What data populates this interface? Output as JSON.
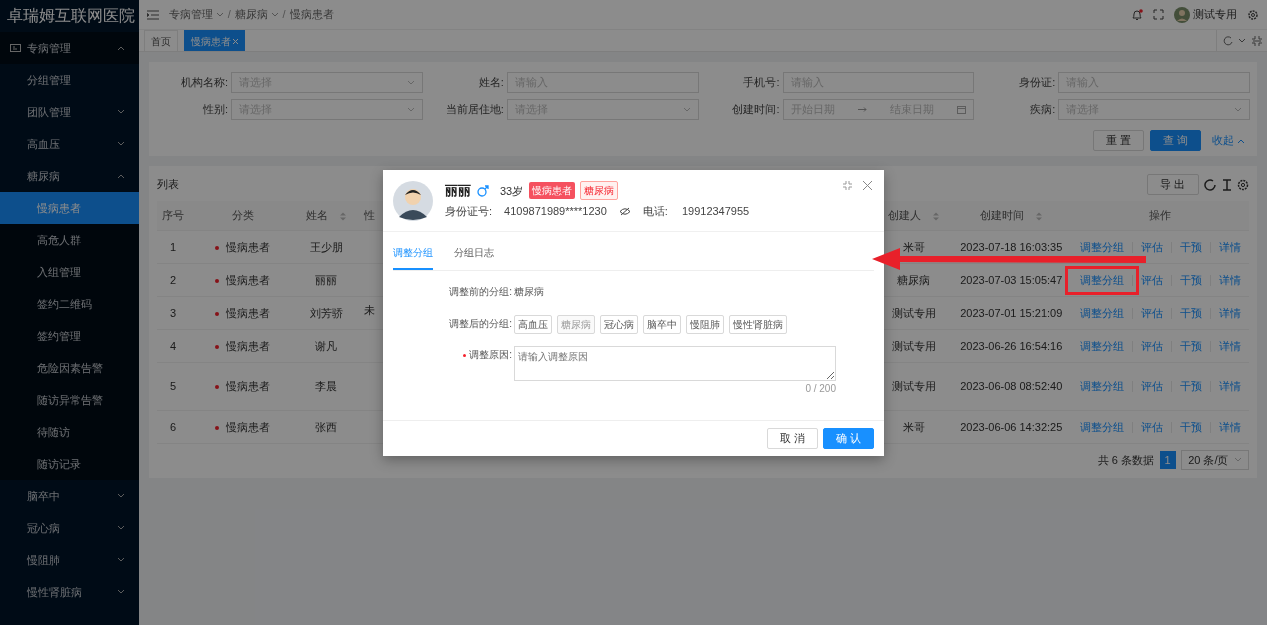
{
  "app_title": "卓瑞姆互联网医院",
  "sidebar": {
    "items": [
      {
        "label": "专病管理",
        "expanded": true,
        "children": [
          {
            "label": "分组管理"
          },
          {
            "label": "团队管理",
            "expanded": false
          },
          {
            "label": "高血压",
            "expanded": false
          },
          {
            "label": "糖尿病",
            "expanded": true,
            "children": [
              {
                "label": "慢病患者",
                "selected": true
              },
              {
                "label": "高危人群",
                "selected": false
              },
              {
                "label": "入组管理",
                "selected": false
              },
              {
                "label": "签约二维码",
                "selected": false
              },
              {
                "label": "签约管理",
                "selected": false
              },
              {
                "label": "危险因素告警",
                "selected": false
              },
              {
                "label": "随访异常告警",
                "selected": false
              },
              {
                "label": "待随访",
                "selected": false
              },
              {
                "label": "随访记录",
                "selected": false
              }
            ]
          },
          {
            "label": "脑卒中",
            "expanded": false
          },
          {
            "label": "冠心病",
            "expanded": false
          },
          {
            "label": "慢阻肺",
            "expanded": false
          },
          {
            "label": "慢性肾脏病",
            "expanded": false
          }
        ]
      }
    ]
  },
  "breadcrumb": {
    "separator": "/",
    "items": [
      {
        "label": "专病管理",
        "dropdown": true
      },
      {
        "label": "糖尿病",
        "dropdown": true
      },
      {
        "label": "慢病患者",
        "dropdown": false
      }
    ]
  },
  "user": {
    "name": "测试专用",
    "notification": true
  },
  "page_tabs": [
    {
      "label": "首页",
      "selected": false,
      "closable": false
    },
    {
      "label": "慢病患者",
      "selected": true,
      "closable": true
    }
  ],
  "filters": [
    {
      "label": "机构名称:",
      "placeholder": "请选择",
      "kind": "select"
    },
    {
      "label": "姓名:",
      "placeholder": "请输入",
      "kind": "input"
    },
    {
      "label": "手机号:",
      "placeholder": "请输入",
      "kind": "input"
    },
    {
      "label": "身份证:",
      "placeholder": "请输入",
      "kind": "input"
    },
    {
      "label": "性别:",
      "placeholder": "请选择",
      "kind": "select"
    },
    {
      "label": "当前居住地:",
      "placeholder": "请选择",
      "kind": "select"
    },
    {
      "label": "创建时间:",
      "placeholder": "开始日期",
      "placeholder_end": "结束日期",
      "kind": "daterange"
    },
    {
      "label": "疾病:",
      "placeholder": "请选择",
      "kind": "select"
    }
  ],
  "filter_buttons": {
    "reset": "重 置",
    "search": "查 询",
    "collapse": "收起"
  },
  "table": {
    "title": "列表",
    "export": "导 出",
    "columns": [
      {
        "label": "序号",
        "sortable": false
      },
      {
        "label": "分类",
        "sortable": false
      },
      {
        "label": "姓名",
        "sortable": true
      },
      {
        "label": "性",
        "sortable": false
      },
      {
        "label": "创建人",
        "sortable": true
      },
      {
        "label": "创建时间",
        "sortable": true
      },
      {
        "label": "操作",
        "sortable": false
      }
    ],
    "rows": [
      {
        "index": "1",
        "category": "慢病患者",
        "name": "王少朋",
        "column_4": "",
        "creator": "米哥",
        "created": "2023-07-18 16:03:35",
        "actions": [
          "调整分组",
          "评估",
          "干预",
          "详情"
        ],
        "highlighted": false
      },
      {
        "index": "2",
        "category": "慢病患者",
        "name": "丽丽",
        "column_4": "",
        "creator": "糖尿病",
        "created": "2023-07-03 15:05:47",
        "actions": [
          "调整分组",
          "评估",
          "干预",
          "详情"
        ],
        "highlighted": true
      },
      {
        "index": "3",
        "category": "慢病患者",
        "name": "刘芳骄",
        "column_4": "未",
        "creator": "测试专用",
        "created": "2023-07-01 15:21:09",
        "actions": [
          "调整分组",
          "评估",
          "干预",
          "详情"
        ],
        "highlighted": false
      },
      {
        "index": "4",
        "category": "慢病患者",
        "name": "谢凡",
        "column_4": "",
        "creator": "测试专用",
        "created": "2023-06-26 16:54:16",
        "actions": [
          "调整分组",
          "评估",
          "干预",
          "详情"
        ],
        "highlighted": false
      },
      {
        "index": "5",
        "category": "慢病患者",
        "name": "李晨",
        "column_4": "",
        "creator": "测试专用",
        "created": "2023-06-08 08:52:40",
        "actions": [
          "调整分组",
          "评估",
          "干预",
          "详情"
        ],
        "highlighted": false
      },
      {
        "index": "6",
        "category": "慢病患者",
        "name": "张西",
        "column_4": "",
        "creator": "米哥",
        "created": "2023-06-06 14:32:25",
        "actions": [
          "调整分组",
          "评估",
          "干预",
          "详情"
        ],
        "highlighted": false
      }
    ],
    "pagination": {
      "total": "共 6 条数据",
      "page": "1",
      "page_size": "20 条/页"
    }
  },
  "dialog": {
    "name": "丽丽",
    "age": "33岁",
    "tags": [
      {
        "label": "慢病患者",
        "kind": "filled"
      },
      {
        "label": "糖尿病",
        "kind": "outline"
      }
    ],
    "id_label": "身份证号:",
    "id_value": "4109871989****1230",
    "phone_label": "电话:",
    "phone_value": "19912347955",
    "tabs": [
      {
        "label": "调整分组",
        "selected": true
      },
      {
        "label": "分组日志",
        "selected": false
      }
    ],
    "before_label": "调整前的分组:",
    "before_value": "糖尿病",
    "after_label": "调整后的分组:",
    "options": [
      {
        "label": "高血压",
        "disabled": false
      },
      {
        "label": "糖尿病",
        "disabled": true
      },
      {
        "label": "冠心病",
        "disabled": false
      },
      {
        "label": "脑卒中",
        "disabled": false
      },
      {
        "label": "慢阻肺",
        "disabled": false
      },
      {
        "label": "慢性肾脏病",
        "disabled": false
      }
    ],
    "reason_label": "调整原因:",
    "reason_required": true,
    "reason_placeholder": "请输入调整原因",
    "reason_counter": "0 / 200",
    "cancel": "取 消",
    "confirm": "确 认"
  }
}
